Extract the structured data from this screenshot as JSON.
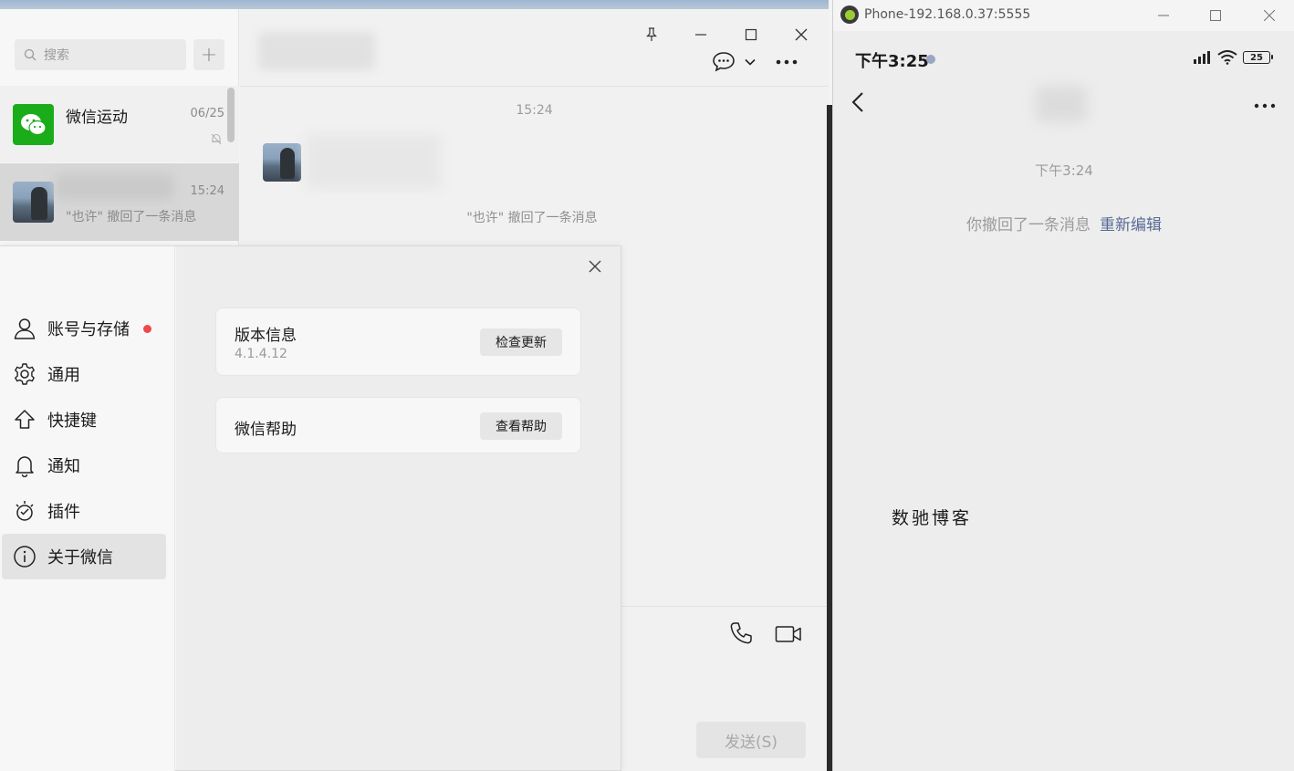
{
  "wechat": {
    "search": {
      "placeholder": "搜索"
    },
    "add_button": "+",
    "chats": [
      {
        "name": "微信运动",
        "time": "06/25",
        "preview": ""
      },
      {
        "name": "",
        "time": "15:24",
        "preview": "\"也许\" 撤回了一条消息"
      }
    ],
    "conversation": {
      "timestamp": "15:24",
      "recall_notice": "\"也许\" 撤回了一条消息",
      "send_button": "发送(S)"
    }
  },
  "settings": {
    "nav": [
      {
        "label": "账号与存储",
        "icon": "user-icon",
        "badge": true
      },
      {
        "label": "通用",
        "icon": "gear-icon"
      },
      {
        "label": "快捷键",
        "icon": "arrow-up-icon"
      },
      {
        "label": "通知",
        "icon": "bell-icon"
      },
      {
        "label": "插件",
        "icon": "plugin-icon"
      },
      {
        "label": "关于微信",
        "icon": "info-icon",
        "active": true
      }
    ],
    "cards": [
      {
        "title": "版本信息",
        "subtitle": "4.1.4.12",
        "button": "检查更新"
      },
      {
        "title": "微信帮助",
        "button": "查看帮助"
      }
    ]
  },
  "phone": {
    "window_title": "Phone-192.168.0.37:5555",
    "status_time": "下午3:25",
    "battery": "25",
    "timestamp": "下午3:24",
    "recall_notice": "你撤回了一条消息",
    "reedit_link": "重新编辑",
    "watermark": "数驰博客"
  },
  "colors": {
    "wechat_green": "#1aad19",
    "link_blue": "#576b95",
    "badge_red": "#f04848"
  }
}
